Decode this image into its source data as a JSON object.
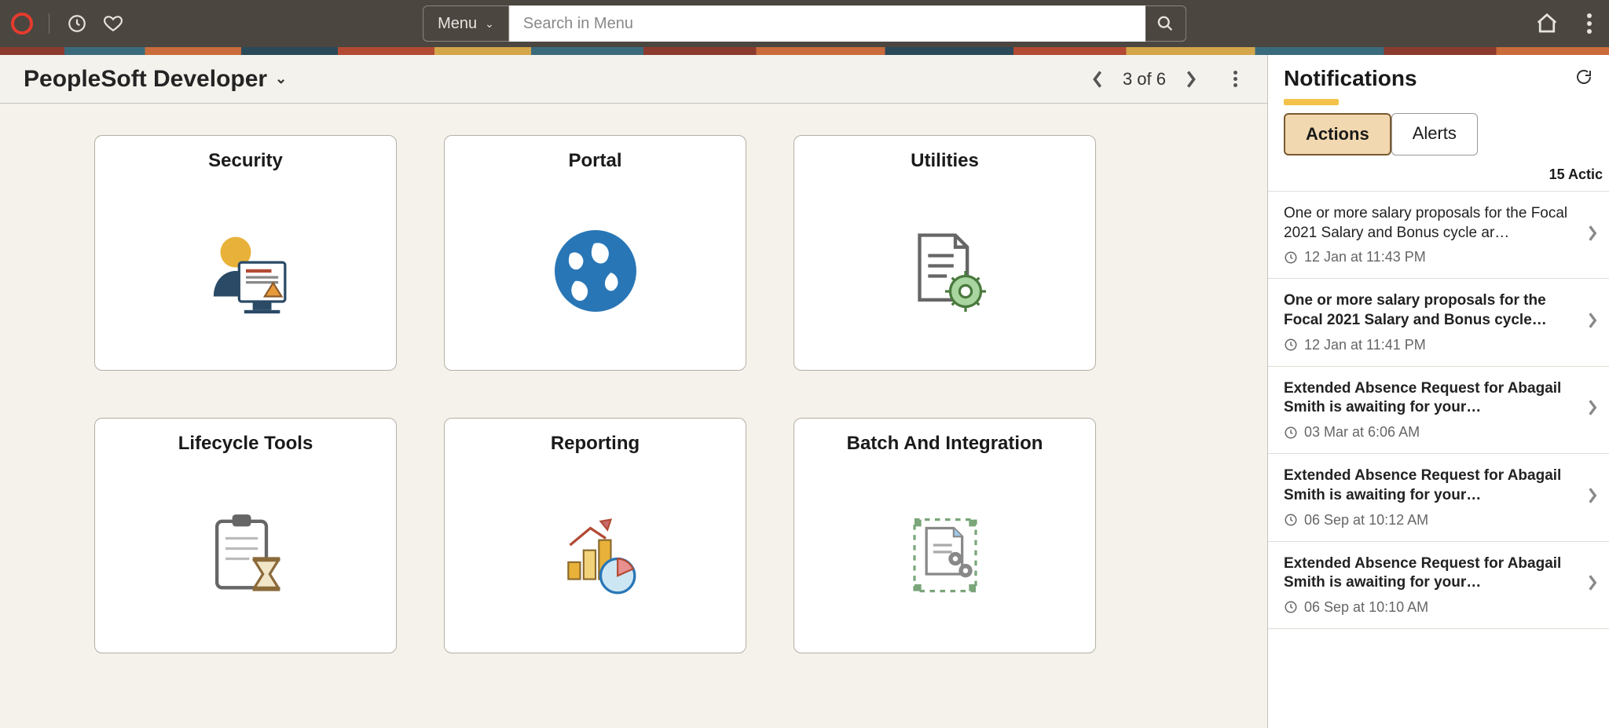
{
  "header": {
    "menu_label": "Menu",
    "search_placeholder": "Search in Menu"
  },
  "page": {
    "title": "PeopleSoft Developer",
    "pager_text": "3 of 6"
  },
  "tiles": [
    {
      "title": "Security"
    },
    {
      "title": "Portal"
    },
    {
      "title": "Utilities"
    },
    {
      "title": "Lifecycle Tools"
    },
    {
      "title": "Reporting"
    },
    {
      "title": "Batch And Integration"
    }
  ],
  "notifications": {
    "title": "Notifications",
    "tabs": {
      "actions": "Actions",
      "alerts": "Alerts"
    },
    "count_label": "15 Actic",
    "items": [
      {
        "text": "One or more salary proposals for the Focal 2021 Salary and Bonus cycle ar…",
        "time": "12 Jan at 11:43 PM",
        "bold": false
      },
      {
        "text": "One or more salary proposals for the Focal 2021 Salary and Bonus cycle…",
        "time": "12 Jan at 11:41 PM",
        "bold": true
      },
      {
        "text": "Extended Absence Request for Abagail Smith is awaiting for your…",
        "time": "03 Mar at 6:06 AM",
        "bold": true
      },
      {
        "text": "Extended Absence Request for Abagail Smith is awaiting for your…",
        "time": "06 Sep at 10:12 AM",
        "bold": true
      },
      {
        "text": "Extended Absence Request for Abagail Smith is awaiting for your…",
        "time": "06 Sep at 10:10 AM",
        "bold": true
      }
    ]
  }
}
